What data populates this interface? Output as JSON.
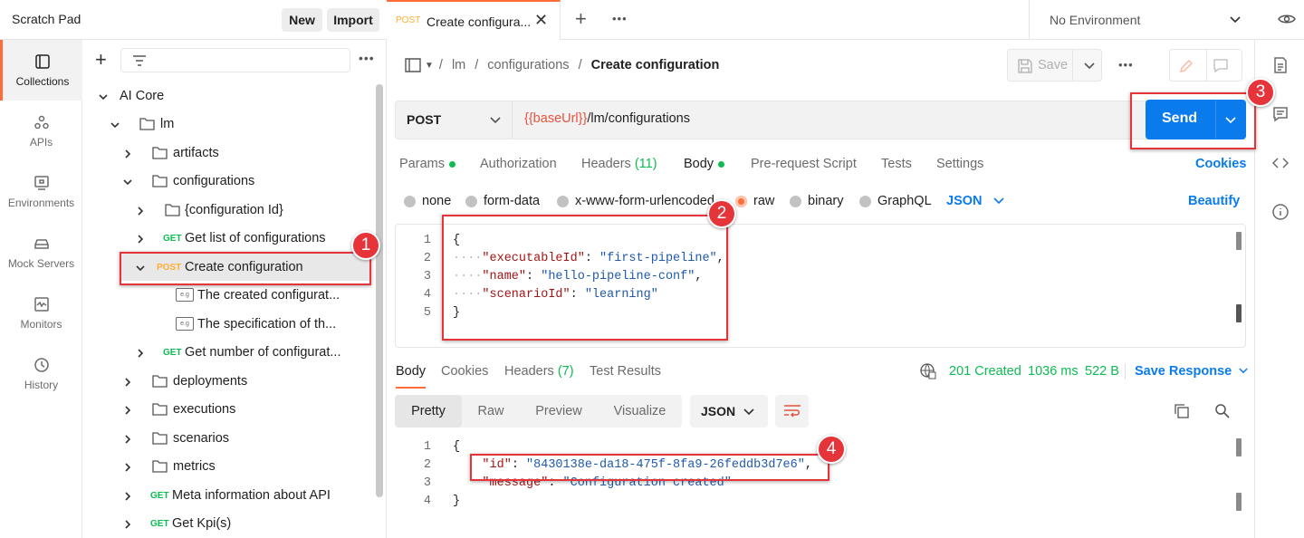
{
  "workspace": {
    "title": "Scratch Pad",
    "new_label": "New",
    "import_label": "Import"
  },
  "rail": [
    {
      "label": "Collections",
      "icon": "collections-icon"
    },
    {
      "label": "APIs",
      "icon": "apis-icon"
    },
    {
      "label": "Environments",
      "icon": "environments-icon"
    },
    {
      "label": "Mock Servers",
      "icon": "mock-servers-icon"
    },
    {
      "label": "Monitors",
      "icon": "monitors-icon"
    },
    {
      "label": "History",
      "icon": "history-icon"
    }
  ],
  "tree": {
    "root": "AI Core",
    "lm": "lm",
    "artifacts": "artifacts",
    "configurations": "configurations",
    "config_id": "{configuration Id}",
    "get_list": "Get list of configurations",
    "create_config": "Create configuration",
    "example1": "The created configurat...",
    "example2": "The specification of th...",
    "get_number": "Get number of configurat...",
    "deployments": "deployments",
    "executions": "executions",
    "scenarios": "scenarios",
    "metrics": "metrics",
    "meta": "Meta information about API",
    "kpi": "Get Kpi(s)",
    "get_method": "GET",
    "post_method": "POST",
    "example_badge": "e.g"
  },
  "tab": {
    "method": "POST",
    "title": "Create configura..."
  },
  "environment": "No Environment",
  "breadcrumb": {
    "part1": "lm",
    "part2": "configurations",
    "current": "Create configuration",
    "sep": "/"
  },
  "save_label": "Save",
  "request": {
    "method": "POST",
    "url_var": "{{baseUrl}}",
    "url_path": "/lm/configurations",
    "send_label": "Send"
  },
  "req_tabs": {
    "params": "Params",
    "authorization": "Authorization",
    "headers": "Headers",
    "headers_count": "(11)",
    "body": "Body",
    "prerequest": "Pre-request Script",
    "tests": "Tests",
    "settings": "Settings",
    "cookies": "Cookies"
  },
  "body_types": {
    "none": "none",
    "formdata": "form-data",
    "urlencoded": "x-www-form-urlencoded",
    "raw": "raw",
    "binary": "binary",
    "graphql": "GraphQL",
    "format": "JSON",
    "beautify": "Beautify"
  },
  "request_body": {
    "lines": [
      "1",
      "2",
      "3",
      "4",
      "5"
    ],
    "open": "{",
    "k1": "\"executableId\"",
    "v1": "\"first-pipeline\"",
    "k2": "\"name\"",
    "v2": "\"hello-pipeline-conf\"",
    "k3": "\"scenarioId\"",
    "v3": "\"learning\"",
    "close": "}"
  },
  "response": {
    "tabs": {
      "body": "Body",
      "cookies": "Cookies",
      "headers": "Headers",
      "headers_count": "(7)",
      "tests": "Test Results"
    },
    "status": "201 Created",
    "time": "1036 ms",
    "size": "522 B",
    "save": "Save Response",
    "views": {
      "pretty": "Pretty",
      "raw": "Raw",
      "preview": "Preview",
      "visualize": "Visualize"
    },
    "format": "JSON",
    "lines": [
      "1",
      "2",
      "3",
      "4"
    ],
    "open": "{",
    "k1": "\"id\"",
    "v1": "\"8430138e-da18-475f-8fa9-26feddb3d7e6\"",
    "k2": "\"message\"",
    "v2": "\"Configuration created\"",
    "close": "}"
  },
  "annotations": {
    "a1": "1",
    "a2": "2",
    "a3": "3",
    "a4": "4"
  },
  "colors": {
    "accent": "#ff6c37",
    "send": "#097bed",
    "get": "#0cbb52",
    "post": "#ffad33",
    "annotation": "#e5353b"
  }
}
